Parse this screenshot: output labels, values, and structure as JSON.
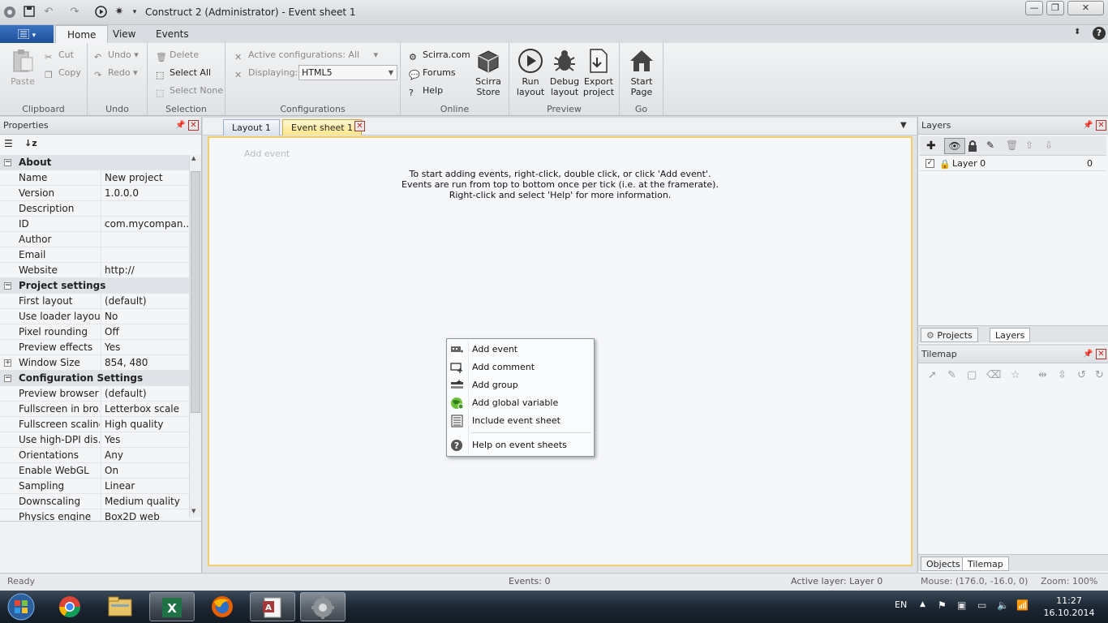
{
  "window": {
    "title": "Construct 2 (Administrator) - Event sheet 1"
  },
  "ribbon": {
    "file_menu_icon": "menu-icon",
    "tabs": [
      "Home",
      "View",
      "Events"
    ],
    "clipboard": {
      "paste": "Paste",
      "cut": "Cut",
      "copy": "Copy",
      "group": "Clipboard"
    },
    "undo": {
      "undo": "Undo",
      "redo": "Redo",
      "group": "Undo"
    },
    "selection": {
      "delete": "Delete",
      "select_all": "Select All",
      "select_none": "Select None",
      "group": "Selection"
    },
    "configurations": {
      "active": "Active configurations: All",
      "displaying_label": "Displaying:",
      "displaying_value": "HTML5",
      "group": "Configurations"
    },
    "online": {
      "scirra": "Scirra.com",
      "forums": "Forums",
      "help": "Help",
      "store_line1": "Scirra",
      "store_line2": "Store",
      "group": "Online"
    },
    "preview": {
      "run_line1": "Run",
      "run_line2": "layout",
      "debug_line1": "Debug",
      "debug_line2": "layout",
      "export_line1": "Export",
      "export_line2": "project",
      "group": "Preview"
    },
    "go": {
      "start_line1": "Start",
      "start_line2": "Page",
      "group": "Go"
    }
  },
  "properties": {
    "title": "Properties",
    "rows": [
      {
        "type": "cat",
        "name": "About",
        "exp": "−"
      },
      {
        "name": "Name",
        "value": "New project"
      },
      {
        "name": "Version",
        "value": "1.0.0.0"
      },
      {
        "name": "Description",
        "value": ""
      },
      {
        "name": "ID",
        "value": "com.mycompan..."
      },
      {
        "name": "Author",
        "value": ""
      },
      {
        "name": "Email",
        "value": ""
      },
      {
        "name": "Website",
        "value": "http://"
      },
      {
        "type": "cat",
        "name": "Project settings",
        "exp": "−"
      },
      {
        "name": "First layout",
        "value": "(default)"
      },
      {
        "name": "Use loader layout",
        "value": "No"
      },
      {
        "name": "Pixel rounding",
        "value": "Off"
      },
      {
        "name": "Preview effects",
        "value": "Yes"
      },
      {
        "name": "Window Size",
        "value": "854, 480",
        "exp": "+"
      },
      {
        "type": "cat",
        "name": "Configuration Settings",
        "exp": "−"
      },
      {
        "name": "Preview browser",
        "value": "(default)"
      },
      {
        "name": "Fullscreen in bro...",
        "value": "Letterbox scale"
      },
      {
        "name": "Fullscreen scaling",
        "value": "High quality"
      },
      {
        "name": "Use high-DPI dis...",
        "value": "Yes"
      },
      {
        "name": "Orientations",
        "value": "Any"
      },
      {
        "name": "Enable WebGL",
        "value": "On"
      },
      {
        "name": "Sampling",
        "value": "Linear"
      },
      {
        "name": "Downscaling",
        "value": "Medium quality"
      },
      {
        "name": "Physics engine",
        "value": "Box2D web"
      }
    ]
  },
  "editor": {
    "tabs": [
      "Layout 1",
      "Event sheet 1"
    ],
    "add_event": "Add event",
    "hint": [
      "To start adding events, right-click, double click, or click 'Add event'.",
      "Events are run from top to bottom once per tick (i.e. at the framerate).",
      "Right-click and select 'Help' for more information."
    ]
  },
  "context_menu": {
    "items": [
      {
        "label": "Add event",
        "icon": "add-event-icon"
      },
      {
        "label": "Add comment",
        "icon": "add-comment-icon"
      },
      {
        "label": "Add group",
        "icon": "add-group-icon"
      },
      {
        "label": "Add global variable",
        "icon": "globe-icon"
      },
      {
        "label": "Include event sheet",
        "icon": "include-sheet-icon"
      },
      {
        "label": "Help on event sheets",
        "icon": "help-icon"
      }
    ]
  },
  "layers": {
    "title": "Layers",
    "rows": [
      {
        "name": "Layer 0",
        "index": "0"
      }
    ],
    "bottom_tabs": [
      "Projects",
      "Layers"
    ]
  },
  "tilemap": {
    "title": "Tilemap",
    "bottom_tabs": [
      "Objects",
      "Tilemap"
    ]
  },
  "status": {
    "state": "Ready",
    "events": "Events: 0",
    "active_layer": "Active layer: Layer 0",
    "mouse": "Mouse: (176.0, -16.0, 0)",
    "zoom": "Zoom: 100%"
  },
  "taskbar": {
    "apps": [
      "chrome-icon",
      "explorer-icon",
      "excel-icon",
      "firefox-icon",
      "access-icon",
      "construct-icon"
    ],
    "lang": "EN",
    "time": "11:27",
    "date": "16.10.2014"
  }
}
